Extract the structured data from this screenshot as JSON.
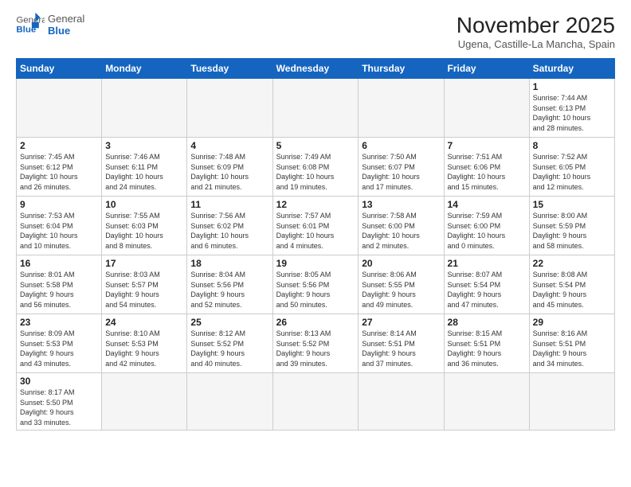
{
  "header": {
    "logo_general": "General",
    "logo_blue": "Blue",
    "title": "November 2025",
    "subtitle": "Ugena, Castille-La Mancha, Spain"
  },
  "weekdays": [
    "Sunday",
    "Monday",
    "Tuesday",
    "Wednesday",
    "Thursday",
    "Friday",
    "Saturday"
  ],
  "weeks": [
    [
      {
        "day": "",
        "info": ""
      },
      {
        "day": "",
        "info": ""
      },
      {
        "day": "",
        "info": ""
      },
      {
        "day": "",
        "info": ""
      },
      {
        "day": "",
        "info": ""
      },
      {
        "day": "",
        "info": ""
      },
      {
        "day": "1",
        "info": "Sunrise: 7:44 AM\nSunset: 6:13 PM\nDaylight: 10 hours\nand 28 minutes."
      }
    ],
    [
      {
        "day": "2",
        "info": "Sunrise: 7:45 AM\nSunset: 6:12 PM\nDaylight: 10 hours\nand 26 minutes."
      },
      {
        "day": "3",
        "info": "Sunrise: 7:46 AM\nSunset: 6:11 PM\nDaylight: 10 hours\nand 24 minutes."
      },
      {
        "day": "4",
        "info": "Sunrise: 7:48 AM\nSunset: 6:09 PM\nDaylight: 10 hours\nand 21 minutes."
      },
      {
        "day": "5",
        "info": "Sunrise: 7:49 AM\nSunset: 6:08 PM\nDaylight: 10 hours\nand 19 minutes."
      },
      {
        "day": "6",
        "info": "Sunrise: 7:50 AM\nSunset: 6:07 PM\nDaylight: 10 hours\nand 17 minutes."
      },
      {
        "day": "7",
        "info": "Sunrise: 7:51 AM\nSunset: 6:06 PM\nDaylight: 10 hours\nand 15 minutes."
      },
      {
        "day": "8",
        "info": "Sunrise: 7:52 AM\nSunset: 6:05 PM\nDaylight: 10 hours\nand 12 minutes."
      }
    ],
    [
      {
        "day": "9",
        "info": "Sunrise: 7:53 AM\nSunset: 6:04 PM\nDaylight: 10 hours\nand 10 minutes."
      },
      {
        "day": "10",
        "info": "Sunrise: 7:55 AM\nSunset: 6:03 PM\nDaylight: 10 hours\nand 8 minutes."
      },
      {
        "day": "11",
        "info": "Sunrise: 7:56 AM\nSunset: 6:02 PM\nDaylight: 10 hours\nand 6 minutes."
      },
      {
        "day": "12",
        "info": "Sunrise: 7:57 AM\nSunset: 6:01 PM\nDaylight: 10 hours\nand 4 minutes."
      },
      {
        "day": "13",
        "info": "Sunrise: 7:58 AM\nSunset: 6:00 PM\nDaylight: 10 hours\nand 2 minutes."
      },
      {
        "day": "14",
        "info": "Sunrise: 7:59 AM\nSunset: 6:00 PM\nDaylight: 10 hours\nand 0 minutes."
      },
      {
        "day": "15",
        "info": "Sunrise: 8:00 AM\nSunset: 5:59 PM\nDaylight: 9 hours\nand 58 minutes."
      }
    ],
    [
      {
        "day": "16",
        "info": "Sunrise: 8:01 AM\nSunset: 5:58 PM\nDaylight: 9 hours\nand 56 minutes."
      },
      {
        "day": "17",
        "info": "Sunrise: 8:03 AM\nSunset: 5:57 PM\nDaylight: 9 hours\nand 54 minutes."
      },
      {
        "day": "18",
        "info": "Sunrise: 8:04 AM\nSunset: 5:56 PM\nDaylight: 9 hours\nand 52 minutes."
      },
      {
        "day": "19",
        "info": "Sunrise: 8:05 AM\nSunset: 5:56 PM\nDaylight: 9 hours\nand 50 minutes."
      },
      {
        "day": "20",
        "info": "Sunrise: 8:06 AM\nSunset: 5:55 PM\nDaylight: 9 hours\nand 49 minutes."
      },
      {
        "day": "21",
        "info": "Sunrise: 8:07 AM\nSunset: 5:54 PM\nDaylight: 9 hours\nand 47 minutes."
      },
      {
        "day": "22",
        "info": "Sunrise: 8:08 AM\nSunset: 5:54 PM\nDaylight: 9 hours\nand 45 minutes."
      }
    ],
    [
      {
        "day": "23",
        "info": "Sunrise: 8:09 AM\nSunset: 5:53 PM\nDaylight: 9 hours\nand 43 minutes."
      },
      {
        "day": "24",
        "info": "Sunrise: 8:10 AM\nSunset: 5:53 PM\nDaylight: 9 hours\nand 42 minutes."
      },
      {
        "day": "25",
        "info": "Sunrise: 8:12 AM\nSunset: 5:52 PM\nDaylight: 9 hours\nand 40 minutes."
      },
      {
        "day": "26",
        "info": "Sunrise: 8:13 AM\nSunset: 5:52 PM\nDaylight: 9 hours\nand 39 minutes."
      },
      {
        "day": "27",
        "info": "Sunrise: 8:14 AM\nSunset: 5:51 PM\nDaylight: 9 hours\nand 37 minutes."
      },
      {
        "day": "28",
        "info": "Sunrise: 8:15 AM\nSunset: 5:51 PM\nDaylight: 9 hours\nand 36 minutes."
      },
      {
        "day": "29",
        "info": "Sunrise: 8:16 AM\nSunset: 5:51 PM\nDaylight: 9 hours\nand 34 minutes."
      }
    ],
    [
      {
        "day": "30",
        "info": "Sunrise: 8:17 AM\nSunset: 5:50 PM\nDaylight: 9 hours\nand 33 minutes."
      },
      {
        "day": "",
        "info": ""
      },
      {
        "day": "",
        "info": ""
      },
      {
        "day": "",
        "info": ""
      },
      {
        "day": "",
        "info": ""
      },
      {
        "day": "",
        "info": ""
      },
      {
        "day": "",
        "info": ""
      }
    ]
  ]
}
